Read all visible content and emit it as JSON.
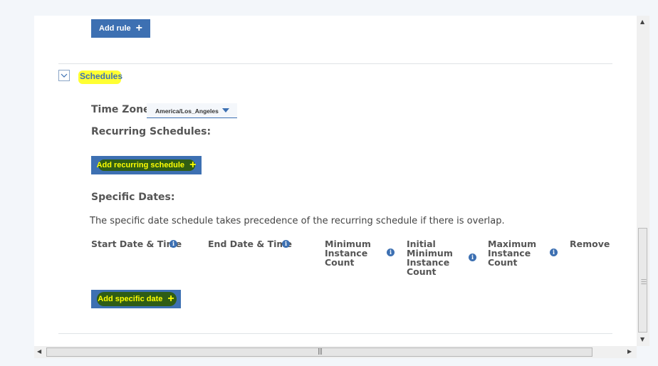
{
  "rules": {
    "add_rule_label": "Add rule"
  },
  "schedules": {
    "section_title": "Schedules",
    "time_zone_label": "Time Zone:",
    "time_zone_value": "America/Los_Angeles",
    "recurring_label": "Recurring Schedules:",
    "add_recurring_label": "Add recurring schedule",
    "specific_dates_label": "Specific Dates:",
    "precedence_note": "The specific date schedule takes precedence of the recurring schedule if there is overlap.",
    "columns": {
      "start": "Start Date & Time",
      "end": "End Date & Time",
      "min_1": "Minimum",
      "min_2": "Instance",
      "min_3": "Count",
      "init_1": "Initial",
      "init_2": "Minimum",
      "init_3": "Instance",
      "init_4": "Count",
      "max_1": "Maximum",
      "max_2": "Instance",
      "max_3": "Count",
      "remove": "Remove"
    },
    "add_specific_date_label": "Add specific date"
  },
  "icons": {
    "plus": "plus-icon",
    "info": "info-icon",
    "chevron": "chevron-down-icon",
    "info_glyph": "i",
    "plus_glyph": "+"
  },
  "colors": {
    "primary": "#3d70b2",
    "highlight_text": "#ffff00",
    "highlight_mark": "#2f5d15",
    "section_highlight": "#ffff33"
  }
}
